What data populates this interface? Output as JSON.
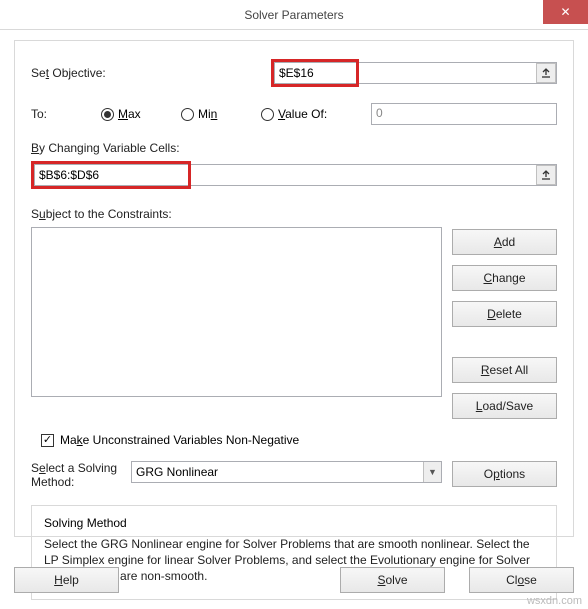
{
  "title": "Solver Parameters",
  "set_objective_label": "Set Objective:",
  "set_objective_value": "$E$16",
  "to_label": "To:",
  "opt_max": "Max",
  "opt_min": "Min",
  "opt_valueof": "Value Of:",
  "valueof_value": "0",
  "changing_label": "By Changing Variable Cells:",
  "changing_value": "$B$6:$D$6",
  "constraints_label": "Subject to the Constraints:",
  "btn_add": "Add",
  "btn_change": "Change",
  "btn_delete": "Delete",
  "btn_resetall": "Reset All",
  "btn_loadsave": "Load/Save",
  "chk_nonneg": "Make Unconstrained Variables Non-Negative",
  "select_method_label1": "Select a Solving",
  "select_method_label2": "Method:",
  "method_value": "GRG Nonlinear",
  "btn_options": "Options",
  "info_head": "Solving Method",
  "info_body": "Select the GRG Nonlinear engine for Solver Problems that are smooth nonlinear. Select the LP Simplex engine for linear Solver Problems, and select the Evolutionary engine for Solver problems that are non-smooth.",
  "btn_help": "Help",
  "btn_solve": "Solve",
  "btn_close": "Close",
  "watermark": "wsxdn.com"
}
